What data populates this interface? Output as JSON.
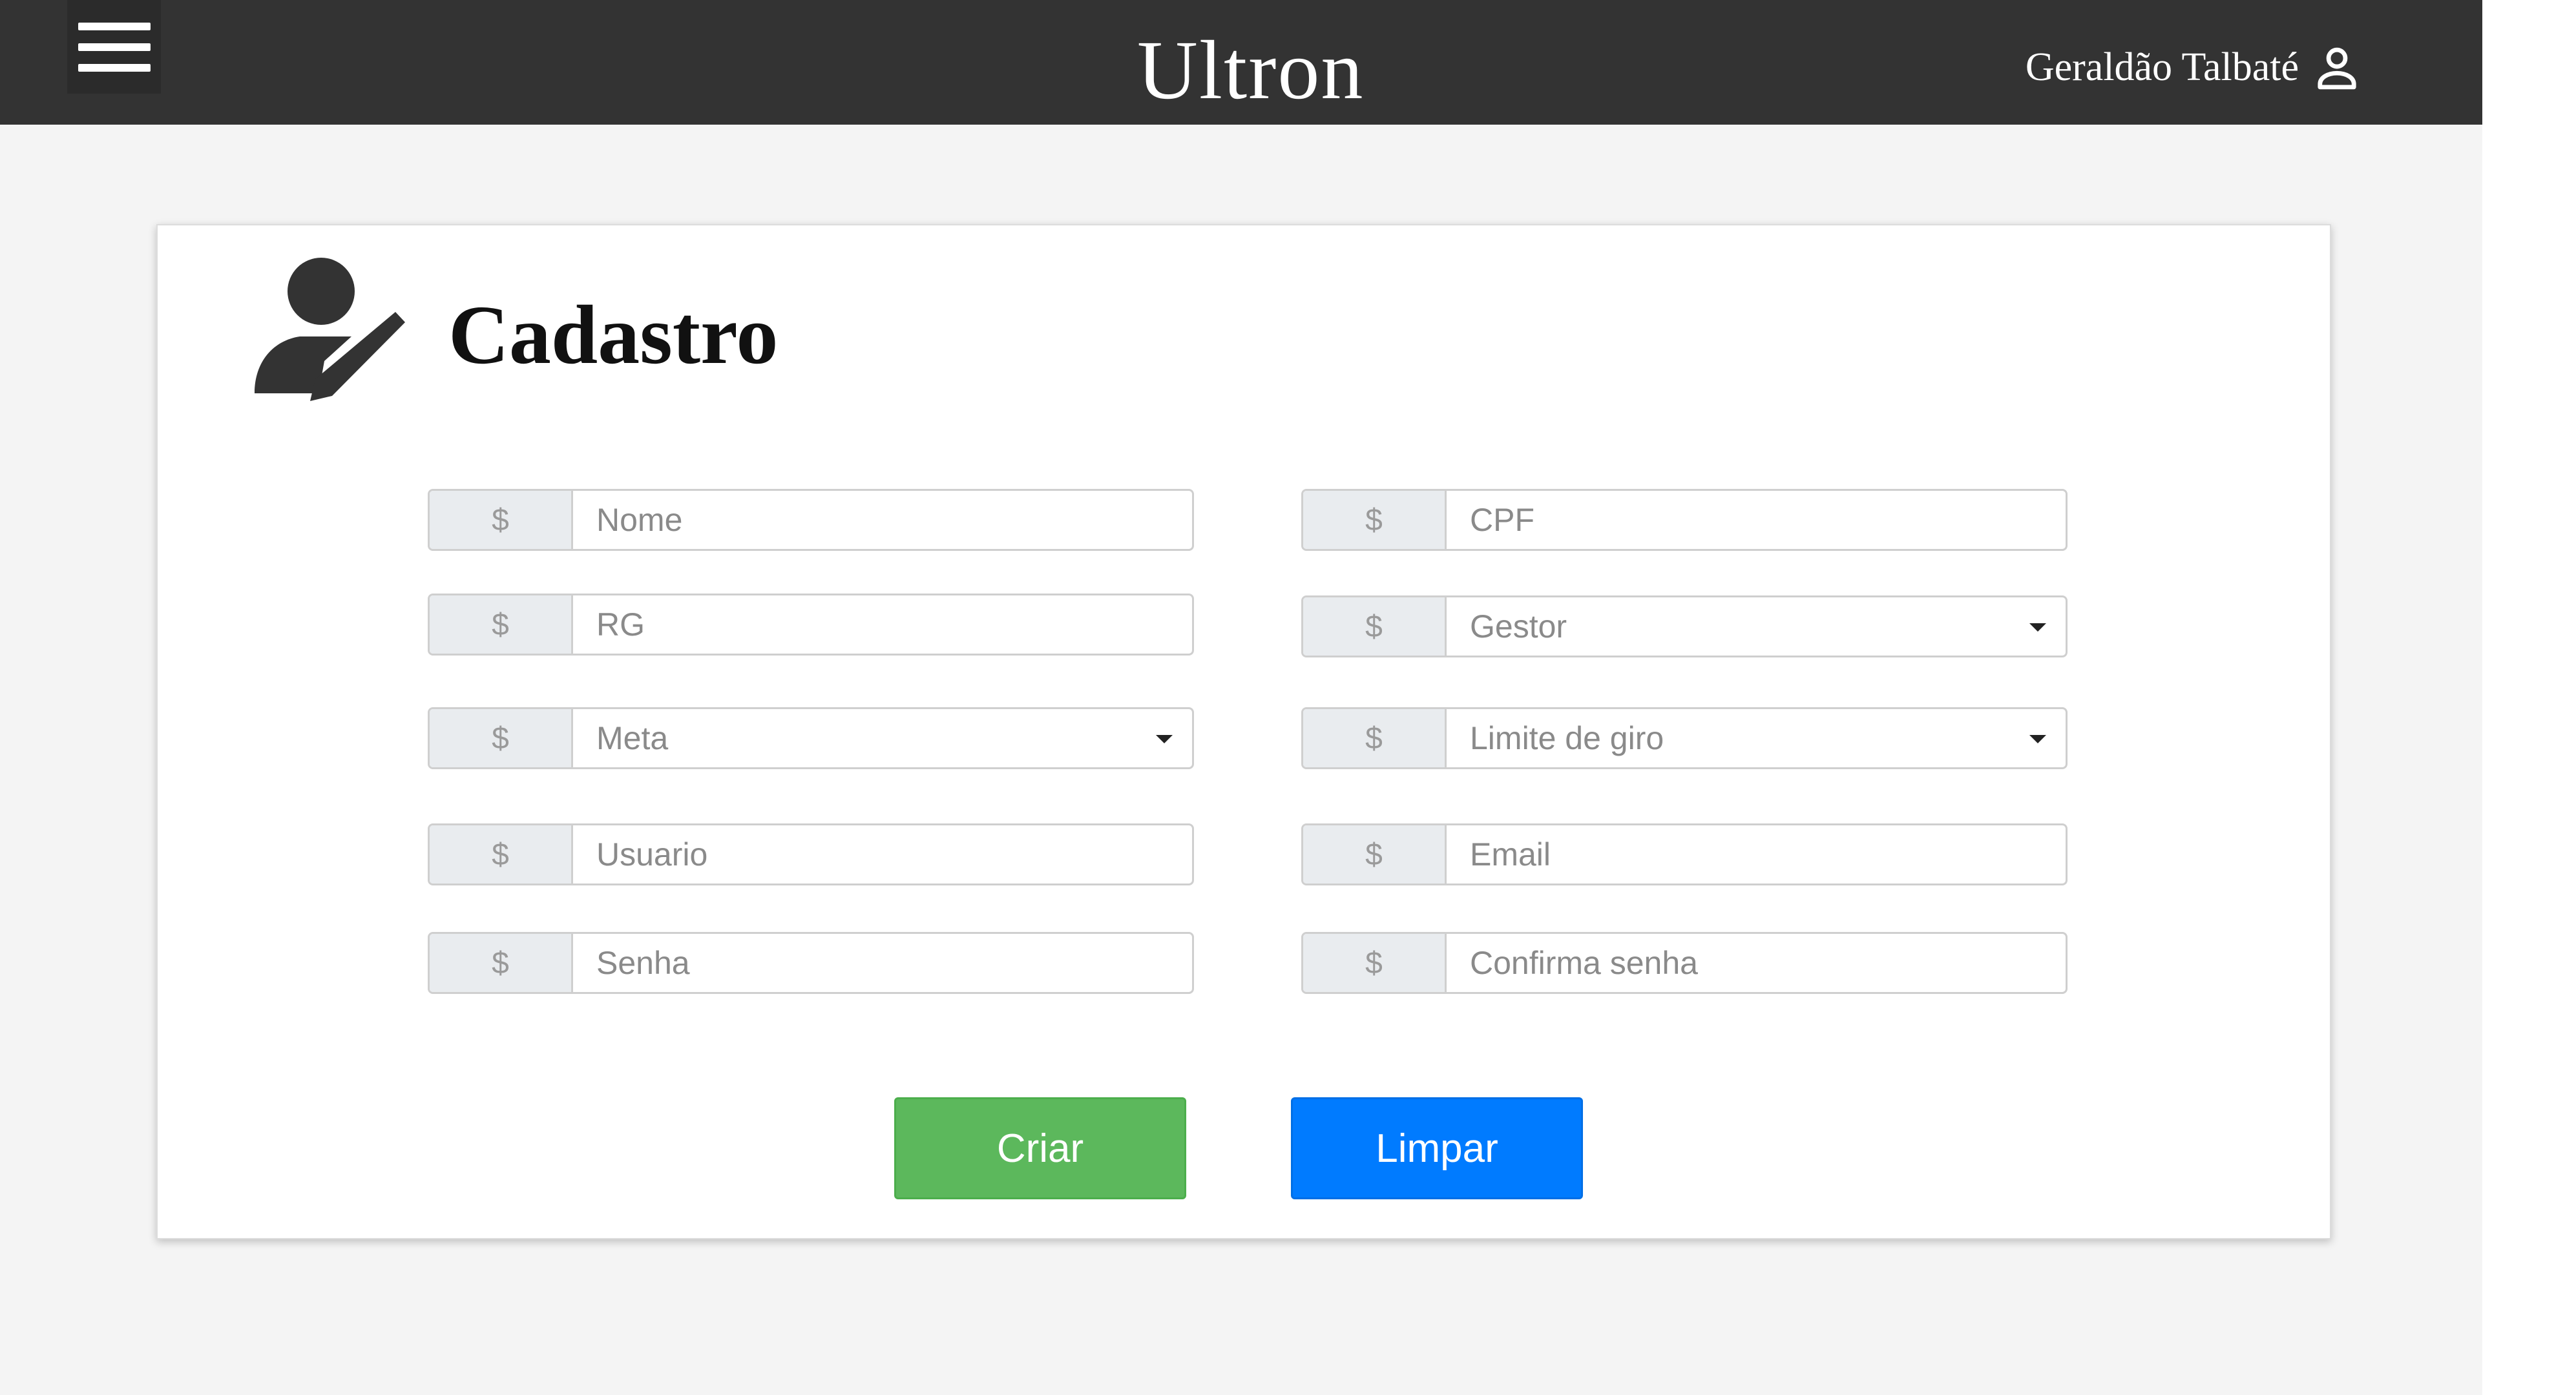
{
  "header": {
    "app_title": "Ultron",
    "user_name": "Geraldão Talbaté"
  },
  "card": {
    "title": "Cadastro"
  },
  "form": {
    "addon_symbol": "$",
    "fields": [
      {
        "type": "input",
        "placeholder": "Nome"
      },
      {
        "type": "input",
        "placeholder": "CPF"
      },
      {
        "type": "input",
        "placeholder": "RG"
      },
      {
        "type": "select",
        "selected": "Gestor"
      },
      {
        "type": "select",
        "selected": "Meta"
      },
      {
        "type": "select",
        "selected": "Limite de giro"
      },
      {
        "type": "input",
        "placeholder": "Usuario"
      },
      {
        "type": "input",
        "placeholder": "Email"
      },
      {
        "type": "input",
        "placeholder": "Senha"
      },
      {
        "type": "input",
        "placeholder": "Confirma senha"
      }
    ]
  },
  "buttons": {
    "create_label": "Criar",
    "clear_label": "Limpar"
  },
  "colors": {
    "topbar": "#333333",
    "create_button": "#5cb85c",
    "clear_button": "#007bff",
    "background": "#f4f4f4"
  },
  "icons": {
    "menu": "hamburger-menu-icon",
    "user": "user-outline-icon",
    "title": "user-edit-icon",
    "select_caret": "caret-down-icon"
  }
}
